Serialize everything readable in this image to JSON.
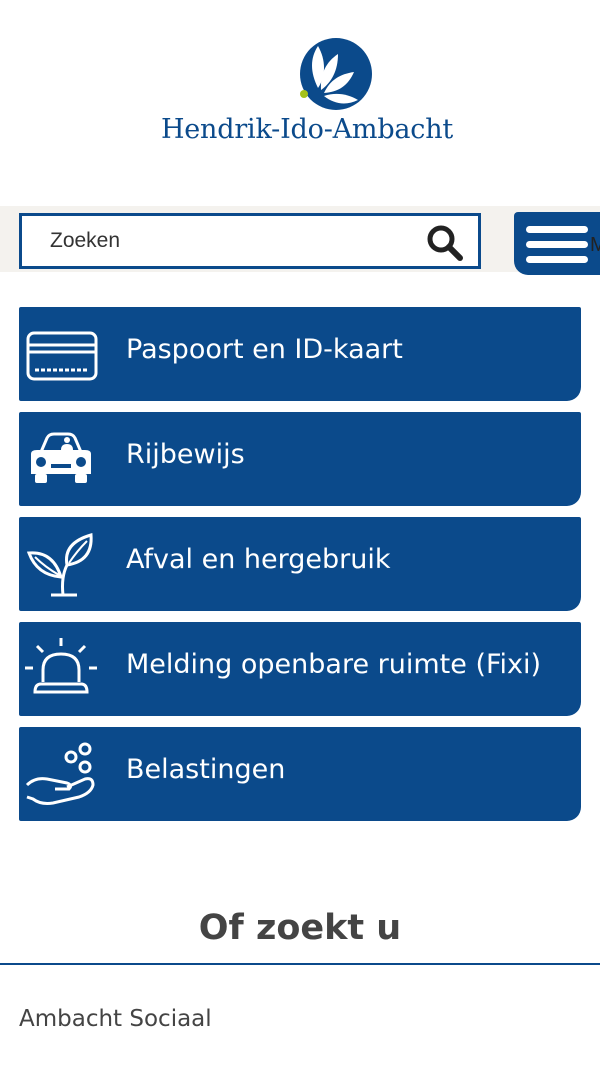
{
  "header": {
    "logo_text": "Hendrik-Ido-Ambacht",
    "logo_icon": "flower-logo-icon"
  },
  "search": {
    "placeholder": "Zoeken",
    "icon": "search-icon"
  },
  "menu": {
    "label": "M",
    "icon": "hamburger-icon"
  },
  "tiles": [
    {
      "label": "Paspoort en ID-kaart",
      "icon": "id-card-icon"
    },
    {
      "label": "Rijbewijs",
      "icon": "car-icon"
    },
    {
      "label": "Afval en hergebruik",
      "icon": "leaf-icon"
    },
    {
      "label": "Melding openbare ruimte (Fixi)",
      "icon": "alarm-light-icon"
    },
    {
      "label": "Belastingen",
      "icon": "coins-hand-icon"
    }
  ],
  "section": {
    "title": "Of zoekt u",
    "items": [
      {
        "label": "Ambacht Sociaal"
      }
    ]
  },
  "colors": {
    "primary": "#0b4a8b",
    "band": "#f4f2ee",
    "text": "#444444",
    "logo_dot": "#a6c21a"
  }
}
